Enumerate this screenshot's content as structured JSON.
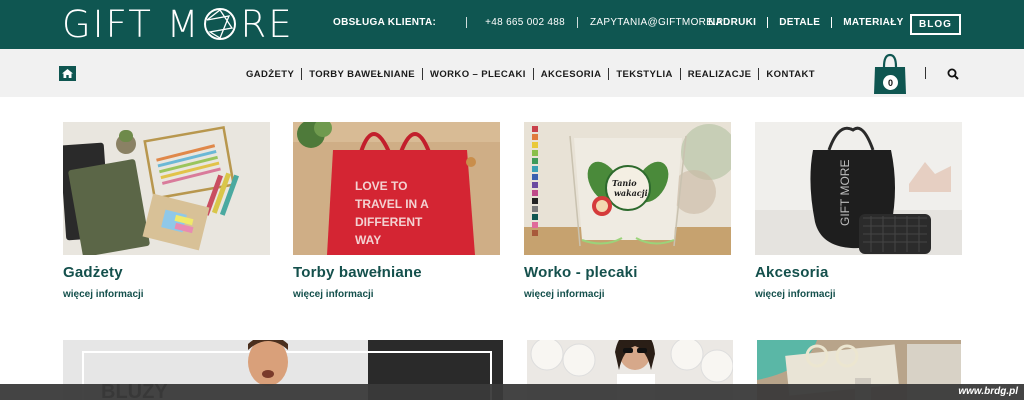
{
  "header": {
    "logo_left": "GIFT M",
    "logo_right": "RE",
    "contact_label": "OBSŁUGA KLIENTA:",
    "phone": "+48 665 002 488",
    "email": "ZAPYTANIA@GIFTMORE.PL",
    "nav": [
      "NADRUKI",
      "DETALE",
      "MATERIAŁY"
    ],
    "blog_label": "BLOG"
  },
  "menu": {
    "items": [
      "GADŻETY",
      "TORBY BAWEŁNIANE",
      "WORKO – PLECAKI",
      "AKCESORIA",
      "TEKSTYLIA",
      "REALIZACJE",
      "KONTAKT"
    ],
    "cart_count": "0"
  },
  "products": [
    {
      "title": "Gadżety",
      "more": "więcej informacji"
    },
    {
      "title": "Torby bawełniane",
      "more": "więcej informacji"
    },
    {
      "title": "Worko - plecaki",
      "more": "więcej informacji"
    },
    {
      "title": "Akcesoria",
      "more": "więcej informacji"
    }
  ],
  "images": {
    "bag_print": "LOVE TO TRAVEL IN A DIFFERENT WAY",
    "backpack_print": "Tanio wakacji",
    "black_bag_print": "GIFT MORE",
    "bluzy_text": "BLUZY"
  },
  "watermark": "www.brdg.pl",
  "colors": {
    "brand": "#0f5651",
    "menu_bg": "#f1f1f1",
    "text_teal": "#14504c"
  }
}
